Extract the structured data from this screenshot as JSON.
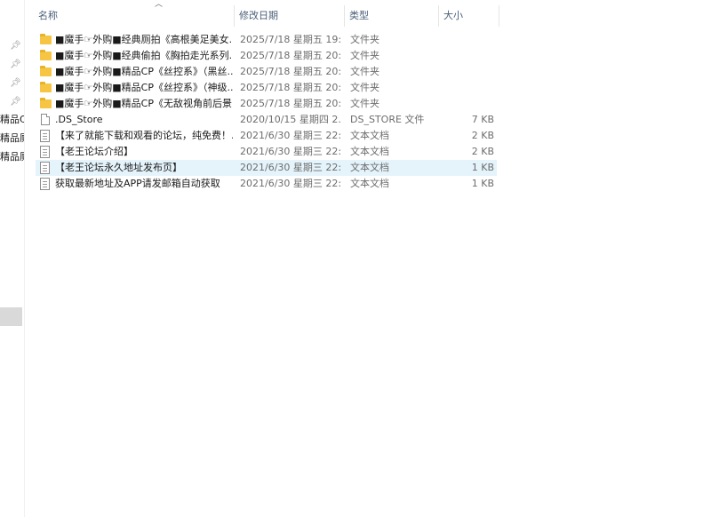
{
  "nav": {
    "labels": [
      "精品CF",
      "精品厕",
      "精品厕"
    ]
  },
  "columns": {
    "name": "名称",
    "date": "修改日期",
    "type": "类型",
    "size": "大小"
  },
  "files": [
    {
      "icon": "folder-icon",
      "name": "■魔手☞外购■经典厕拍《高根美足美女...",
      "date": "2025/7/18 星期五 19:...",
      "type": "文件夹",
      "size": ""
    },
    {
      "icon": "folder-icon",
      "name": "■魔手☞外购■经典偷拍《胸拍走光系列...",
      "date": "2025/7/18 星期五 20:...",
      "type": "文件夹",
      "size": ""
    },
    {
      "icon": "folder-icon",
      "name": "■魔手☞外购■精品CP《丝控系》（黑丝...",
      "date": "2025/7/18 星期五 20:...",
      "type": "文件夹",
      "size": ""
    },
    {
      "icon": "folder-icon",
      "name": "■魔手☞外购■精品CP《丝控系》（神级...",
      "date": "2025/7/18 星期五 20:...",
      "type": "文件夹",
      "size": ""
    },
    {
      "icon": "folder-icon",
      "name": "■魔手☞外购■精品CP《无敌视角前后景...",
      "date": "2025/7/18 星期五 20:...",
      "type": "文件夹",
      "size": ""
    },
    {
      "icon": "file-icon",
      "name": ".DS_Store",
      "date": "2020/10/15 星期四 2...",
      "type": "DS_STORE 文件",
      "size": "7 KB"
    },
    {
      "icon": "text-file-icon",
      "name": "【来了就能下载和观看的论坛，纯免费！...",
      "date": "2021/6/30 星期三 22:...",
      "type": "文本文档",
      "size": "2 KB"
    },
    {
      "icon": "text-file-icon",
      "name": "【老王论坛介绍】",
      "date": "2021/6/30 星期三 22:...",
      "type": "文本文档",
      "size": "2 KB"
    },
    {
      "icon": "text-file-icon",
      "name": "【老王论坛永久地址发布页】",
      "date": "2021/6/30 星期三 22:...",
      "type": "文本文档",
      "size": "1 KB",
      "selected": true
    },
    {
      "icon": "text-file-icon",
      "name": "获取最新地址及APP请发邮箱自动获取",
      "date": "2021/6/30 星期三 22:...",
      "type": "文本文档",
      "size": "1 KB"
    }
  ],
  "colors": {
    "folder": "#f6c543",
    "selection": "#e5f3fb",
    "header_text": "#4c607a"
  }
}
